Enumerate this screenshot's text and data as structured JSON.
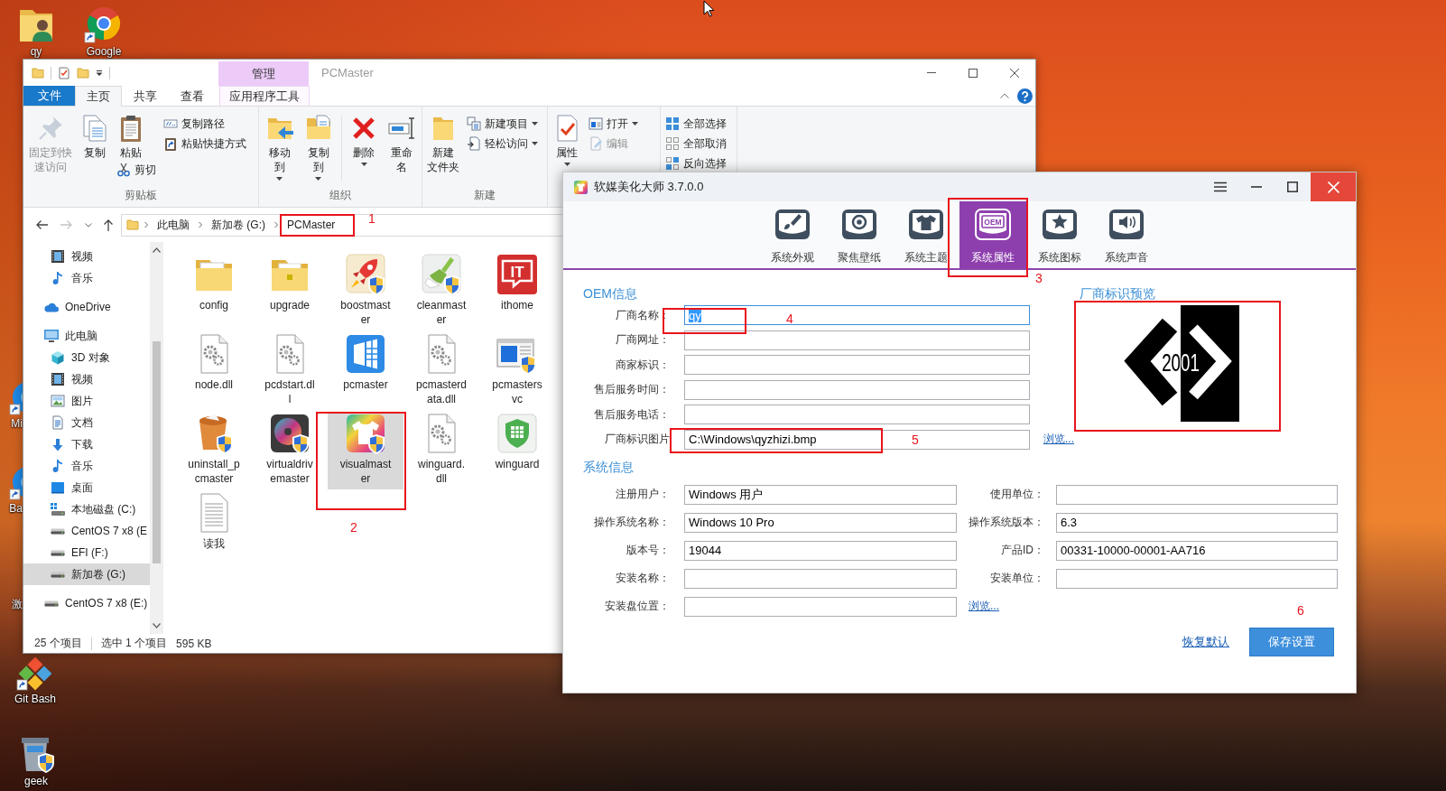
{
  "desktop_icons": [
    {
      "label": "qy"
    },
    {
      "label": "Google"
    },
    {
      "label": "Mi"
    },
    {
      "label": "Ba"
    },
    {
      "label": "激"
    },
    {
      "label": "Git Bash"
    },
    {
      "label": "geek"
    }
  ],
  "explorer": {
    "context_header": "管理",
    "title": "PCMaster",
    "tabs": [
      {
        "label": "文件",
        "kind": "file",
        "selected": false
      },
      {
        "label": "主页",
        "kind": "tab",
        "selected": true
      },
      {
        "label": "共享",
        "kind": "tab",
        "selected": false
      },
      {
        "label": "查看",
        "kind": "tab",
        "selected": false
      },
      {
        "label": "应用程序工具",
        "kind": "context",
        "selected": false
      }
    ],
    "ribbon": [
      {
        "label": "剪贴板",
        "columns": [
          [
            {
              "label": "固定到快速访问",
              "kind": "large",
              "dropdown": false,
              "disabled": true
            }
          ],
          [
            {
              "label": "复制",
              "kind": "large",
              "dropdown": false,
              "disabled": false
            }
          ],
          [
            {
              "label": "粘贴",
              "kind": "large",
              "dropdown": false,
              "disabled": false
            },
            {
              "label": "剪切",
              "kind": "small",
              "dropdown": false,
              "disabled": false
            }
          ],
          [
            {
              "label": "复制路径",
              "kind": "small",
              "dropdown": false,
              "disabled": false
            },
            {
              "label": "粘贴快捷方式",
              "kind": "small",
              "dropdown": false,
              "disabled": false
            }
          ]
        ]
      },
      {
        "label": "组织",
        "columns": [
          [
            {
              "label": "移动到",
              "kind": "large",
              "dropdown": true,
              "disabled": false
            }
          ],
          [
            {
              "label": "复制到",
              "kind": "large",
              "dropdown": true,
              "disabled": false
            }
          ],
          [
            {
              "label": "删除",
              "kind": "large",
              "dropdown": true,
              "disabled": false
            }
          ],
          [
            {
              "label": "重命名",
              "kind": "large",
              "dropdown": false,
              "disabled": false
            }
          ]
        ]
      },
      {
        "label": "新建",
        "columns": [
          [
            {
              "lines": [
                "新建",
                "文件夹"
              ],
              "kind": "large",
              "dropdown": false,
              "disabled": false
            }
          ],
          [
            {
              "label": "新建项目",
              "kind": "small",
              "dropdown": true,
              "disabled": false
            },
            {
              "label": "轻松访问",
              "kind": "small",
              "dropdown": true,
              "disabled": false
            }
          ]
        ]
      },
      {
        "columns": [
          [
            {
              "label": "属性",
              "kind": "large",
              "dropdown": true,
              "disabled": false
            }
          ],
          [
            {
              "label": "打开",
              "kind": "small",
              "dropdown": true,
              "disabled": false
            },
            {
              "label": "编辑",
              "kind": "small",
              "dropdown": false,
              "disabled": true
            }
          ]
        ]
      },
      {
        "columns": [
          [
            {
              "label": "全部选择",
              "kind": "small",
              "dropdown": false,
              "disabled": false
            },
            {
              "label": "全部取消",
              "kind": "small",
              "dropdown": false,
              "disabled": false
            },
            {
              "label": "反向选择",
              "kind": "small",
              "dropdown": false,
              "disabled": false
            }
          ]
        ]
      }
    ],
    "navigation": {
      "back_enabled": true,
      "forward_enabled": false
    },
    "breadcrumb": [
      "此电脑",
      "新加卷 (G:)",
      "PCMaster"
    ],
    "nav_tree": [
      {
        "children": [
          {
            "label": "视频",
            "selected": false
          },
          {
            "label": "音乐",
            "selected": false
          }
        ]
      },
      {
        "label": "OneDrive",
        "selected": false
      },
      {
        "label": "此电脑",
        "selected": false,
        "children": [
          {
            "label": "3D 对象",
            "selected": false
          },
          {
            "label": "视频",
            "selected": false
          },
          {
            "label": "图片",
            "selected": false
          },
          {
            "label": "文档",
            "selected": false
          },
          {
            "label": "下载",
            "selected": false
          },
          {
            "label": "音乐",
            "selected": false
          },
          {
            "label": "桌面",
            "selected": false
          },
          {
            "label": "本地磁盘 (C:)",
            "selected": false
          },
          {
            "label": "CentOS 7 x8 (E",
            "selected": false
          },
          {
            "label": "EFI (F:)",
            "selected": false
          },
          {
            "label": "新加卷 (G:)",
            "selected": true
          }
        ]
      },
      {
        "label": "CentOS 7 x8 (E:)",
        "selected": false
      }
    ],
    "files": [
      {
        "name": "config",
        "selected": false
      },
      {
        "name": "upgrade",
        "selected": false
      },
      {
        "name": "boostmaster",
        "selected": false
      },
      {
        "name": "cleanmaster",
        "selected": false
      },
      {
        "name": "ithome",
        "selected": false,
        "icon_text": "IT"
      },
      {
        "name": "node.dll",
        "selected": false
      },
      {
        "name": "pcdstart.dll",
        "selected": false
      },
      {
        "name": "pcmaster",
        "selected": false
      },
      {
        "name": "pcmasterdata.dll",
        "selected": false
      },
      {
        "name": "pcmastersvc",
        "selected": false
      },
      {
        "name": "uninstall_pcmaster",
        "selected": false
      },
      {
        "name": "virtualdrivemaster",
        "selected": false
      },
      {
        "name": "visualmaster",
        "selected": true
      },
      {
        "name": "winguard.dll",
        "selected": false
      },
      {
        "name": "winguard",
        "selected": false
      },
      {
        "name": "读我",
        "selected": false
      }
    ],
    "status_bar": {
      "item_count": "25 个项目",
      "selection": "选中 1 个项目",
      "size": "595 KB"
    }
  },
  "dialog": {
    "title": "软媒美化大师 3.7.0.0",
    "tabs": [
      {
        "label": "系统外观",
        "selected": false
      },
      {
        "label": "聚焦壁纸",
        "selected": false
      },
      {
        "label": "系统主题",
        "selected": false
      },
      {
        "label": "系统属性",
        "selected": true,
        "icon_text": "OEM"
      },
      {
        "label": "系统图标",
        "selected": false
      },
      {
        "label": "系统声音",
        "selected": false
      }
    ],
    "oem": {
      "heading": "OEM信息",
      "fields": [
        {
          "label": "厂商名称：",
          "value": "qy",
          "focused": true
        },
        {
          "label": "厂商网址：",
          "focused": false
        },
        {
          "label": "商家标识：",
          "focused": false
        },
        {
          "label": "售后服务时间：",
          "focused": false
        },
        {
          "label": "售后服务电话：",
          "focused": false
        },
        {
          "label": "厂商标识图片",
          "value": "C:\\Windows\\qyzhizi.bmp",
          "focused": false,
          "link": "浏览..."
        }
      ]
    },
    "preview": {
      "heading": "厂商标识预览",
      "logo_text": "2001"
    },
    "system": {
      "heading": "系统信息",
      "fields": [
        {
          "label": "注册用户：",
          "value": "Windows 用户",
          "focused": false
        },
        {
          "label": "使用单位：",
          "focused": false
        },
        {
          "label": "操作系统名称：",
          "value": "Windows 10 Pro",
          "focused": false
        },
        {
          "label": "操作系统版本：",
          "value": "6.3",
          "focused": false
        },
        {
          "label": "版本号：",
          "value": "19044",
          "focused": false
        },
        {
          "label": "产品ID：",
          "value": "00331-10000-00001-AA716",
          "focused": false
        },
        {
          "label": "安装名称：",
          "focused": false
        },
        {
          "label": "安装单位：",
          "focused": false
        },
        {
          "label": "安装盘位置：",
          "focused": false,
          "link": "浏览..."
        }
      ]
    },
    "restore_link": "恢复默认",
    "save_button": "保存设置"
  },
  "annotations": [
    "1",
    "2",
    "3",
    "4",
    "5",
    "6"
  ]
}
